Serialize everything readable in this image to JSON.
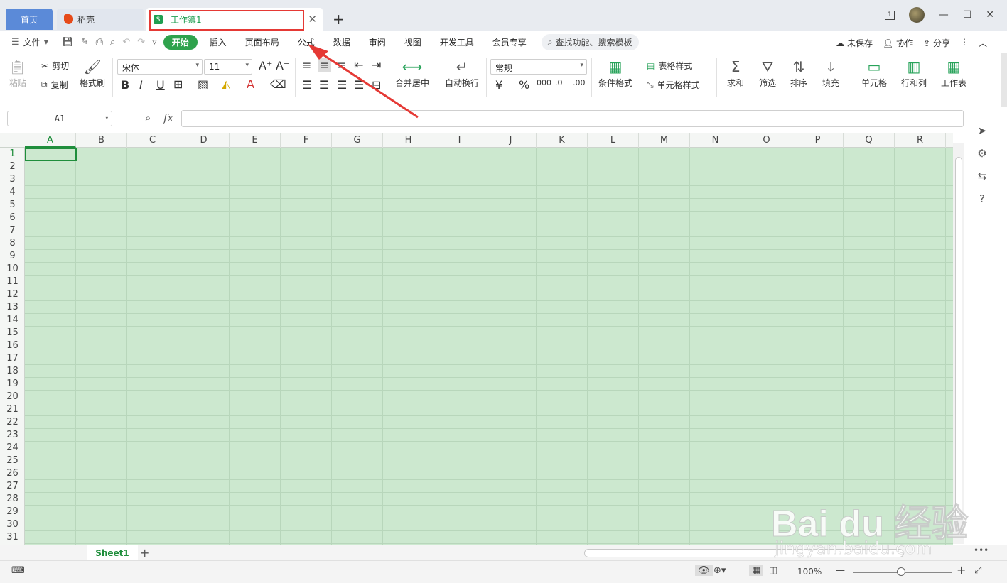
{
  "tabs": {
    "home": "首页",
    "daoke": "稻壳",
    "workbook": "工作簿1"
  },
  "window": {
    "page_indicator": "1"
  },
  "menu": {
    "file": "文件",
    "items": [
      "开始",
      "插入",
      "页面布局",
      "公式",
      "数据",
      "审阅",
      "视图",
      "开发工具",
      "会员专享"
    ],
    "active_index": 0,
    "search": "查找功能、搜索模板",
    "unsaved": "未保存",
    "collab": "协作",
    "share": "分享"
  },
  "ribbon": {
    "paste": "粘贴",
    "cut": "剪切",
    "copy": "复制",
    "format_painter": "格式刷",
    "font_name": "宋体",
    "font_size": "11",
    "merge_center": "合并居中",
    "wrap_text": "自动换行",
    "number_format": "常规",
    "conditional_format": "条件格式",
    "table_style": "表格样式",
    "cell_style": "单元格样式",
    "sum": "求和",
    "filter": "筛选",
    "sort": "排序",
    "fill": "填充",
    "cell": "单元格",
    "row_col": "行和列",
    "worksheet": "工作表"
  },
  "formula_bar": {
    "name_box": "A1",
    "fx_label": "fx",
    "value": ""
  },
  "grid": {
    "columns": [
      "A",
      "B",
      "C",
      "D",
      "E",
      "F",
      "G",
      "H",
      "I",
      "J",
      "K",
      "L",
      "M",
      "N",
      "O",
      "P",
      "Q",
      "R"
    ],
    "rows": [
      "1",
      "2",
      "3",
      "4",
      "5",
      "6",
      "7",
      "8",
      "9",
      "10",
      "11",
      "12",
      "13",
      "14",
      "15",
      "16",
      "17",
      "18",
      "19",
      "20",
      "21",
      "22",
      "23",
      "24",
      "25",
      "26",
      "27",
      "28",
      "29",
      "30",
      "31"
    ],
    "selected_cell": "A1",
    "cell_color": "#cce8cf"
  },
  "sheets": {
    "active": "Sheet1"
  },
  "status": {
    "zoom": "100%"
  },
  "watermark": {
    "big": "Bai du 经验",
    "small": "jingyan.baidu.com"
  },
  "colors": {
    "accent": "#2fa24d",
    "highlight": "#e53935"
  }
}
